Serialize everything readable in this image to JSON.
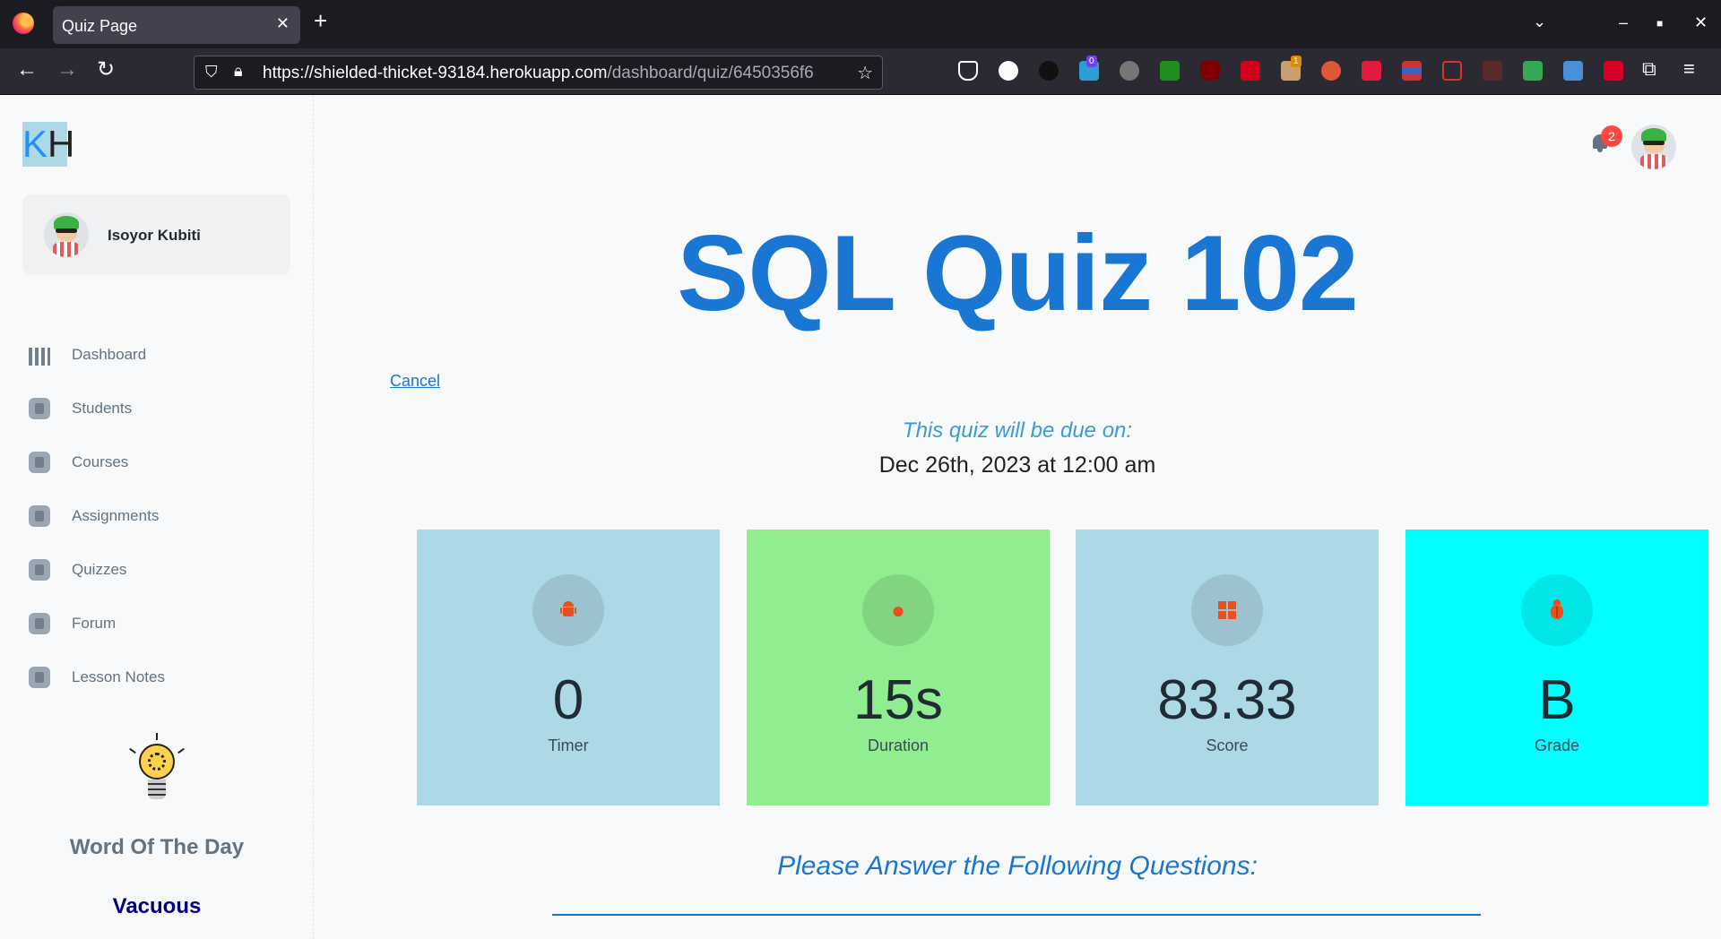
{
  "browser": {
    "tab_title": "Quiz Page",
    "url_host": "https://shielded-thicket-93184.herokuapp.com",
    "url_path": "/dashboard/quiz/6450356f6",
    "extension_badges": [
      "0",
      "1"
    ]
  },
  "sidebar": {
    "logo": {
      "k": "K",
      "h": "H"
    },
    "user_name": "Isoyor Kubiti",
    "menu": [
      {
        "label": "Dashboard"
      },
      {
        "label": "Students"
      },
      {
        "label": "Courses"
      },
      {
        "label": "Assignments"
      },
      {
        "label": "Quizzes"
      },
      {
        "label": "Forum"
      },
      {
        "label": "Lesson Notes"
      }
    ],
    "word_of_day_title": "Word Of The Day",
    "word_of_day": "Vacuous"
  },
  "header": {
    "notification_count": "2"
  },
  "main": {
    "title": "SQL Quiz 102",
    "cancel_label": "Cancel",
    "due_label": "This quiz will be due on:",
    "due_date": "Dec 26th, 2023 at 12:00 am",
    "cards": [
      {
        "value": "0",
        "label": "Timer",
        "icon": "android-icon",
        "bg": "#add8e6"
      },
      {
        "value": "15s",
        "label": "Duration",
        "icon": "apple-icon",
        "bg": "#90ee90"
      },
      {
        "value": "83.33",
        "label": "Score",
        "icon": "windows-icon",
        "bg": "#add8e6"
      },
      {
        "value": "B",
        "label": "Grade",
        "icon": "bug-icon",
        "bg": "#00ffff"
      }
    ],
    "questions_heading": "Please Answer the Following Questions:"
  },
  "colors": {
    "accent": "#1976d2",
    "icon": "#e8501f"
  }
}
